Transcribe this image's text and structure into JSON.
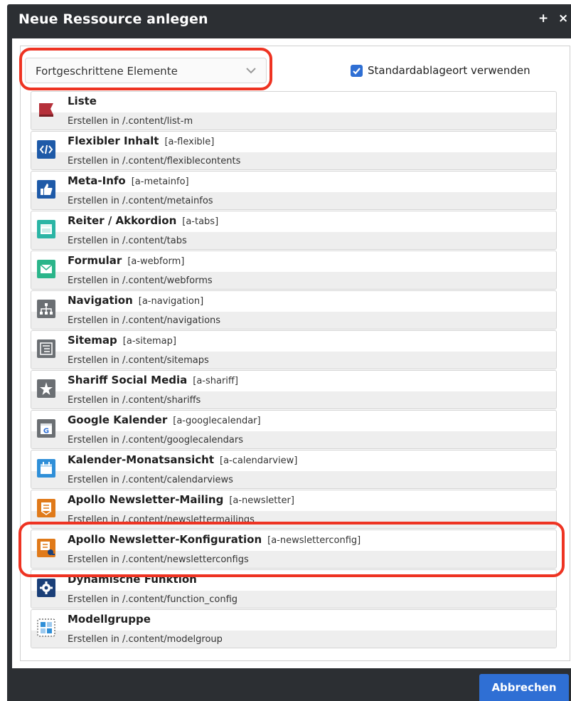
{
  "dialog": {
    "title": "Neue Ressource anlegen",
    "actions": {
      "add_label": "+",
      "close_label": "×"
    }
  },
  "filter": {
    "selected": "Fortgeschrittene Elemente",
    "arrow_icon": "chevron-down-icon"
  },
  "options": {
    "use_default_location": {
      "label": "Standardablageort verwenden",
      "checked": true
    }
  },
  "items": [
    {
      "name": "Liste",
      "tag": "",
      "path": "Erstellen in /.content/list-m",
      "icon": "list-icon",
      "color": "#b5303a"
    },
    {
      "name": "Flexibler Inhalt",
      "tag": "[a-flexible]",
      "path": "Erstellen in /.content/flexiblecontents",
      "icon": "code-icon",
      "color": "#1e5aa8"
    },
    {
      "name": "Meta-Info",
      "tag": "[a-metainfo]",
      "path": "Erstellen in /.content/metainfos",
      "icon": "thumbs-up-icon",
      "color": "#1e5aa8"
    },
    {
      "name": "Reiter / Akkordion",
      "tag": "[a-tabs]",
      "path": "Erstellen in /.content/tabs",
      "icon": "tabs-icon",
      "color": "#2bb5a5"
    },
    {
      "name": "Formular",
      "tag": "[a-webform]",
      "path": "Erstellen in /.content/webforms",
      "icon": "envelope-icon",
      "color": "#2bb58a"
    },
    {
      "name": "Navigation",
      "tag": "[a-navigation]",
      "path": "Erstellen in /.content/navigations",
      "icon": "sitemap-icon",
      "color": "#6b6f73"
    },
    {
      "name": "Sitemap",
      "tag": "[a-sitemap]",
      "path": "Erstellen in /.content/sitemaps",
      "icon": "tree-list-icon",
      "color": "#6b6f73"
    },
    {
      "name": "Shariff Social Media",
      "tag": "[a-shariff]",
      "path": "Erstellen in /.content/shariffs",
      "icon": "star-icon",
      "color": "#6b6f73"
    },
    {
      "name": "Google Kalender",
      "tag": "[a-googlecalendar]",
      "path": "Erstellen in /.content/googlecalendars",
      "icon": "google-calendar-icon",
      "color": "#6b6f73"
    },
    {
      "name": "Kalender-Monatsansicht",
      "tag": "[a-calendarview]",
      "path": "Erstellen in /.content/calendarviews",
      "icon": "calendar-icon",
      "color": "#2f8fd8"
    },
    {
      "name": "Apollo Newsletter-Mailing",
      "tag": "[a-newsletter]",
      "path": "Erstellen in /.content/newslettermailings",
      "icon": "newsletter-icon",
      "color": "#e07a1a"
    },
    {
      "name": "Apollo Newsletter-Konfiguration",
      "tag": "[a-newsletterconfig]",
      "path": "Erstellen in /.content/newsletterconfigs",
      "icon": "newsletter-config-icon",
      "color": "#e07a1a"
    },
    {
      "name": "Dynamische Funktion",
      "tag": "",
      "path": "Erstellen in /.content/function_config",
      "icon": "gear-icon",
      "color": "#1a3f78"
    },
    {
      "name": "Modellgruppe",
      "tag": "",
      "path": "Erstellen in /.content/modelgroup",
      "icon": "model-group-icon",
      "color": "#2f8fd8"
    }
  ],
  "footer": {
    "cancel_label": "Abbrechen"
  },
  "colors": {
    "highlight": "#ee3322",
    "accent": "#2f6fd4",
    "titlebar": "#2c2f33"
  }
}
